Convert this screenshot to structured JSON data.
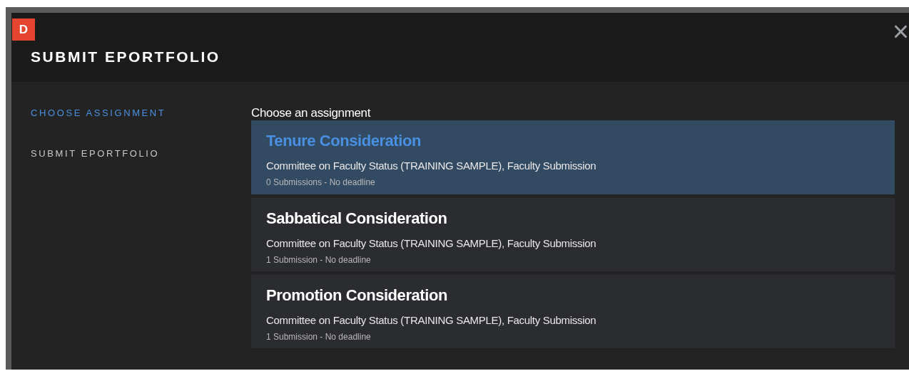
{
  "badge": {
    "letter": "D"
  },
  "window": {
    "title": "SUBMIT EPORTFOLIO",
    "close": "×"
  },
  "steps": [
    {
      "label": "CHOOSE ASSIGNMENT",
      "selected": true
    },
    {
      "label": "SUBMIT EPORTFOLIO",
      "selected": false
    }
  ],
  "heading": "Choose an assignment",
  "assignments": [
    {
      "title": "Tenure Consideration",
      "committee": "Committee on Faculty Status (TRAINING SAMPLE), Faculty Submission",
      "info": "0 Submissions - No deadline",
      "selected": true
    },
    {
      "title": "Sabbatical Consideration",
      "committee": "Committee on Faculty Status (TRAINING SAMPLE), Faculty Submission",
      "info": "1 Submission - No deadline",
      "selected": false
    },
    {
      "title": "Promotion Consideration",
      "committee": "Committee on Faculty Status (TRAINING SAMPLE), Faculty Submission",
      "info": "1 Submission - No deadline",
      "selected": false
    }
  ]
}
